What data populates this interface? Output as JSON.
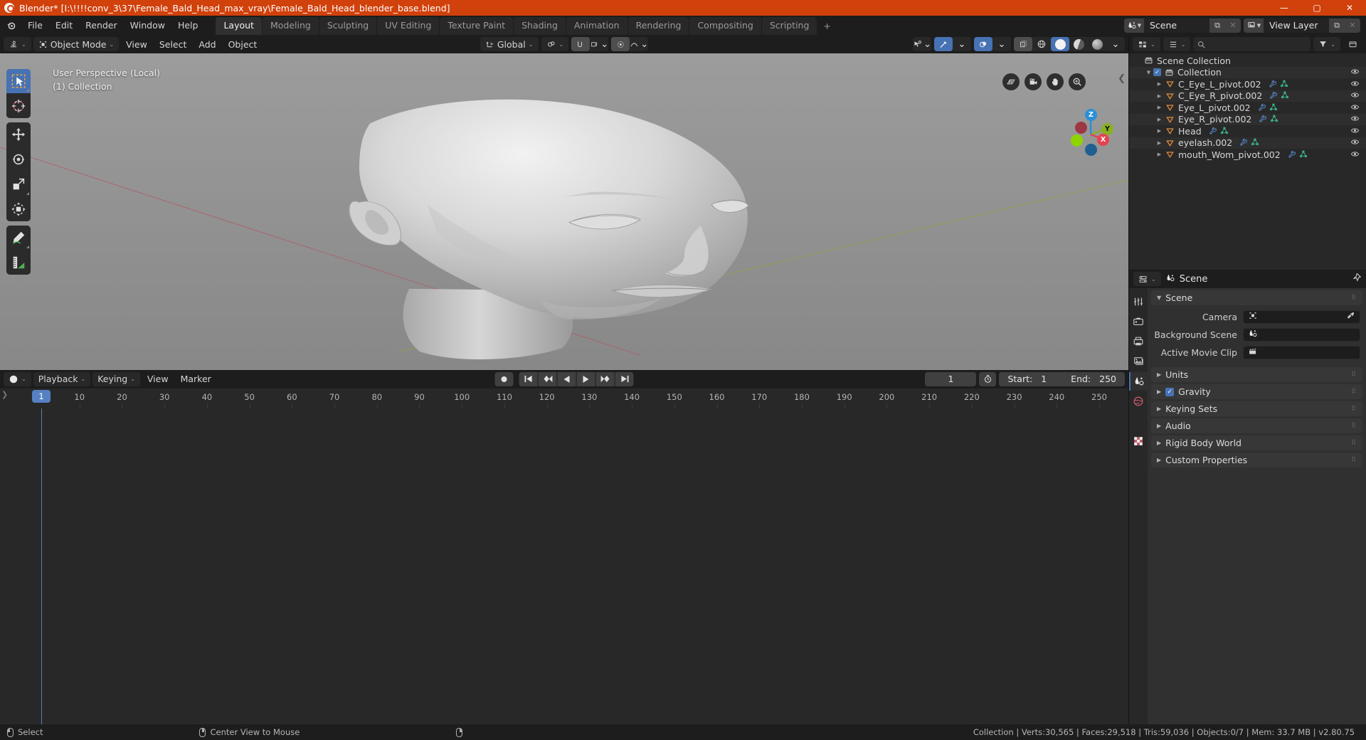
{
  "window": {
    "title": "Blender* [I:\\!!!!conv_3\\37\\Female_Bald_Head_max_vray\\Female_Bald_Head_blender_base.blend]",
    "minimize": "—",
    "maximize": "▢",
    "close": "✕"
  },
  "topbar": {
    "menus": [
      "File",
      "Edit",
      "Render",
      "Window",
      "Help"
    ],
    "workspaces": [
      {
        "label": "Layout",
        "active": true
      },
      {
        "label": "Modeling",
        "active": false
      },
      {
        "label": "Sculpting",
        "active": false
      },
      {
        "label": "UV Editing",
        "active": false
      },
      {
        "label": "Texture Paint",
        "active": false
      },
      {
        "label": "Shading",
        "active": false
      },
      {
        "label": "Animation",
        "active": false
      },
      {
        "label": "Rendering",
        "active": false
      },
      {
        "label": "Compositing",
        "active": false
      },
      {
        "label": "Scripting",
        "active": false
      }
    ],
    "add_workspace": "+",
    "scene_name": "Scene",
    "viewlayer_name": "View Layer",
    "dup_icon": "⧉",
    "x_icon": "✕"
  },
  "viewport_header": {
    "mode": "Object Mode",
    "menus": [
      "View",
      "Select",
      "Add",
      "Object"
    ],
    "transform_orientation": "Global",
    "chev": "⌄"
  },
  "viewport": {
    "perspective_line1": "User Perspective (Local)",
    "perspective_line2": "(1) Collection",
    "gizmo_axes": [
      {
        "label": "Z",
        "color": "#2a8fd8"
      },
      {
        "label": "Y",
        "color": "#89b023"
      },
      {
        "label": "X",
        "color": "#e4434f"
      }
    ],
    "nav_icons": [
      "grid-icon",
      "camera-icon",
      "hand-icon",
      "zoom-icon"
    ],
    "tools": [
      {
        "name": "tweak-select-tool",
        "active": true
      },
      {
        "name": "cursor-tool",
        "active": false
      },
      {
        "name": "move-tool",
        "active": false
      },
      {
        "name": "rotate-tool",
        "active": false
      },
      {
        "name": "scale-tool",
        "active": false
      },
      {
        "name": "transform-tool",
        "active": false
      },
      {
        "name": "annotate-tool",
        "active": false
      },
      {
        "name": "measure-tool",
        "active": false
      }
    ]
  },
  "timeline": {
    "editor_menu_icon": "clock-icon",
    "menus": [
      "Playback",
      "Keying",
      "View",
      "Marker"
    ],
    "current_frame": "1",
    "start_label": "Start:",
    "start_value": "1",
    "end_label": "End:",
    "end_value": "250",
    "ticks": [
      "10",
      "20",
      "30",
      "40",
      "50",
      "60",
      "70",
      "80",
      "90",
      "100",
      "110",
      "120",
      "130",
      "140",
      "150",
      "160",
      "170",
      "180",
      "190",
      "200",
      "210",
      "220",
      "230",
      "240",
      "250"
    ],
    "playhead_label": "1"
  },
  "outliner": {
    "header_search_placeholder": "",
    "rows": [
      {
        "indent": 0,
        "icon": "collection-icon",
        "label": "Scene Collection",
        "disclosure": "",
        "check": false,
        "data_icons": [],
        "eye": false
      },
      {
        "indent": 1,
        "icon": "collection-icon",
        "label": "Collection",
        "disclosure": "▼",
        "check": true,
        "data_icons": [],
        "eye": true
      },
      {
        "indent": 2,
        "icon": "object-icon",
        "label": "C_Eye_L_pivot.002",
        "disclosure": "▶",
        "check": false,
        "data_icons": [
          "modifier-icon",
          "mesh-data-icon"
        ],
        "eye": true
      },
      {
        "indent": 2,
        "icon": "object-icon",
        "label": "C_Eye_R_pivot.002",
        "disclosure": "▶",
        "check": false,
        "data_icons": [
          "modifier-icon",
          "mesh-data-icon"
        ],
        "eye": true
      },
      {
        "indent": 2,
        "icon": "object-icon",
        "label": "Eye_L_pivot.002",
        "disclosure": "▶",
        "check": false,
        "data_icons": [
          "modifier-icon",
          "mesh-data-icon"
        ],
        "eye": true
      },
      {
        "indent": 2,
        "icon": "object-icon",
        "label": "Eye_R_pivot.002",
        "disclosure": "▶",
        "check": false,
        "data_icons": [
          "modifier-icon",
          "mesh-data-icon"
        ],
        "eye": true
      },
      {
        "indent": 2,
        "icon": "object-icon",
        "label": "Head",
        "disclosure": "▶",
        "check": false,
        "data_icons": [
          "modifier-icon",
          "mesh-data-icon"
        ],
        "eye": true
      },
      {
        "indent": 2,
        "icon": "object-icon",
        "label": "eyelash.002",
        "disclosure": "▶",
        "check": false,
        "data_icons": [
          "modifier-icon",
          "mesh-data-icon"
        ],
        "eye": true
      },
      {
        "indent": 2,
        "icon": "object-icon",
        "label": "mouth_Wom_pivot.002",
        "disclosure": "▶",
        "check": false,
        "data_icons": [
          "modifier-icon",
          "mesh-data-icon"
        ],
        "eye": true
      }
    ]
  },
  "properties": {
    "breadcrumb": "Scene",
    "pin_icon": "pin-icon",
    "tabs": [
      {
        "name": "tool-tab",
        "active": false
      },
      {
        "name": "render-tab",
        "active": false
      },
      {
        "name": "output-tab",
        "active": false
      },
      {
        "name": "viewlayer-tab",
        "active": false
      },
      {
        "name": "scene-tab",
        "active": true
      },
      {
        "name": "world-tab",
        "active": false
      },
      {
        "name": "texture-tab",
        "active": false
      }
    ],
    "panels": [
      {
        "label": "Scene",
        "open": true,
        "tri": "▼"
      },
      {
        "label": "Units",
        "open": false,
        "tri": "▶"
      },
      {
        "label": "Gravity",
        "open": false,
        "tri": "▶",
        "checkbox": true
      },
      {
        "label": "Keying Sets",
        "open": false,
        "tri": "▶"
      },
      {
        "label": "Audio",
        "open": false,
        "tri": "▶"
      },
      {
        "label": "Rigid Body World",
        "open": false,
        "tri": "▶"
      },
      {
        "label": "Custom Properties",
        "open": false,
        "tri": "▶"
      }
    ],
    "fields": [
      {
        "label": "Camera",
        "value": "",
        "icon": "camera-object-icon",
        "eyedropper": true
      },
      {
        "label": "Background Scene",
        "value": "",
        "icon": "scene-icon",
        "eyedropper": false
      },
      {
        "label": "Active Movie Clip",
        "value": "",
        "icon": "clip-icon",
        "eyedropper": false
      }
    ],
    "grip": "⣿"
  },
  "statusbar": {
    "left_items": [
      {
        "mouse": "left",
        "label": "Select"
      },
      {
        "mouse": "middle",
        "label": "Center View to Mouse"
      },
      {
        "mouse": "right",
        "label": ""
      }
    ],
    "stats": "Collection | Verts:30,565 | Faces:29,518 | Tris:59,036 | Objects:0/7 | Mem: 33.7 MB | v2.80.75"
  },
  "colors": {
    "title_orange": "#d1410c",
    "accent_blue": "#4772b3",
    "panel_bg": "#303030",
    "editor_bg": "#282828"
  }
}
